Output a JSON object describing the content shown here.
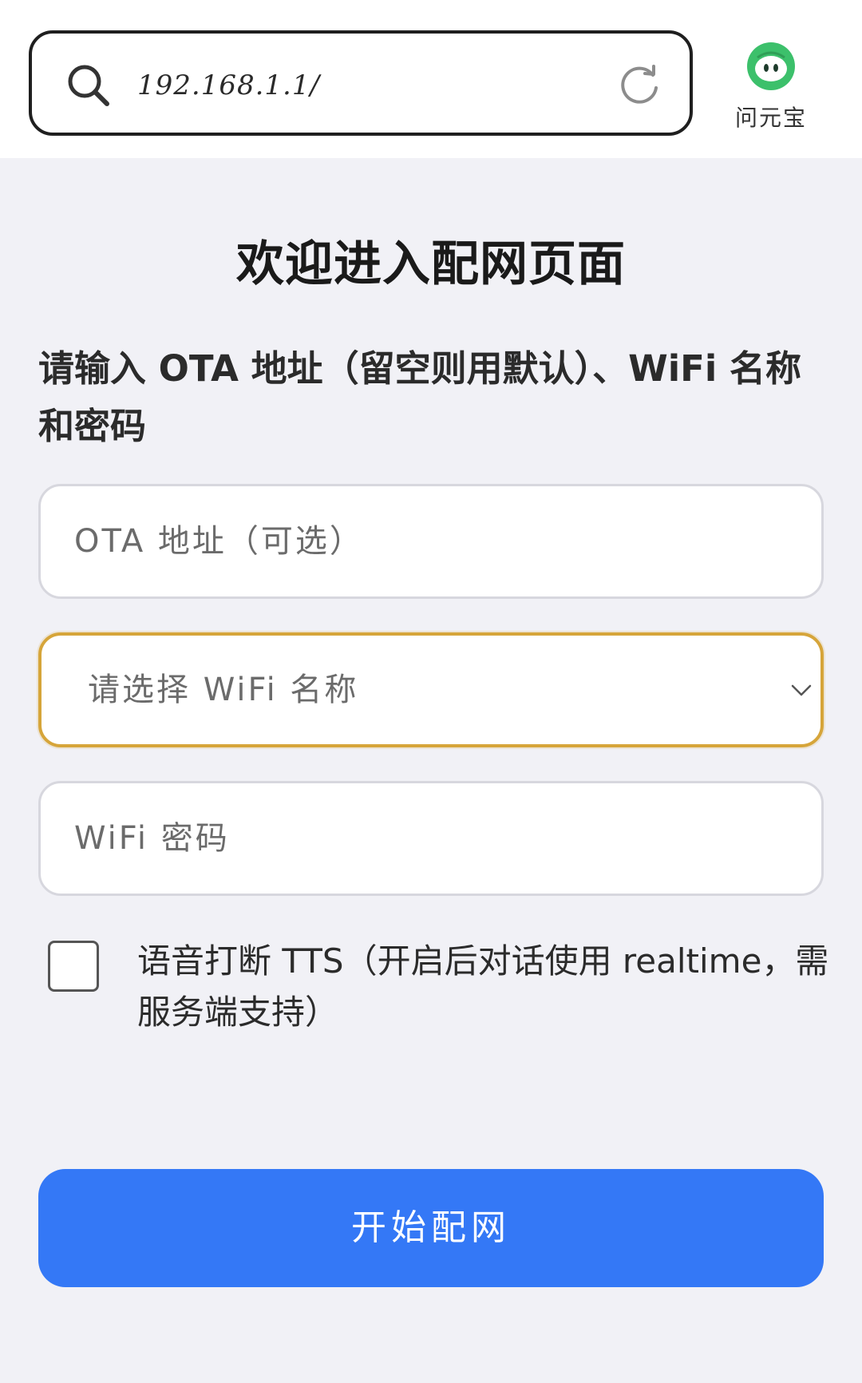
{
  "browser": {
    "url": "192.168.1.1/",
    "icons": {
      "search": "search-icon",
      "reload": "reload-icon"
    },
    "assistant": {
      "label": "问元宝",
      "icon": "yuanbao-logo-icon",
      "color": "#3cc06b"
    }
  },
  "page": {
    "title": "欢迎进入配网页面",
    "instructions": "请输入 OTA 地址（留空则用默认）、WiFi 名称和密码"
  },
  "form": {
    "ota": {
      "placeholder": "OTA 地址（可选）",
      "value": ""
    },
    "ssid": {
      "placeholder": "请选择 WiFi 名称",
      "value": "",
      "focus_color": "#d6a53a"
    },
    "password": {
      "placeholder": "WiFi 密码",
      "value": ""
    },
    "tts": {
      "label": "语音打断 TTS（开启后对话使用 realtime，需服务端支持）",
      "checked": false
    },
    "submit_label": "开始配网"
  },
  "colors": {
    "accent": "#3478f6",
    "background": "#f1f1f6"
  }
}
